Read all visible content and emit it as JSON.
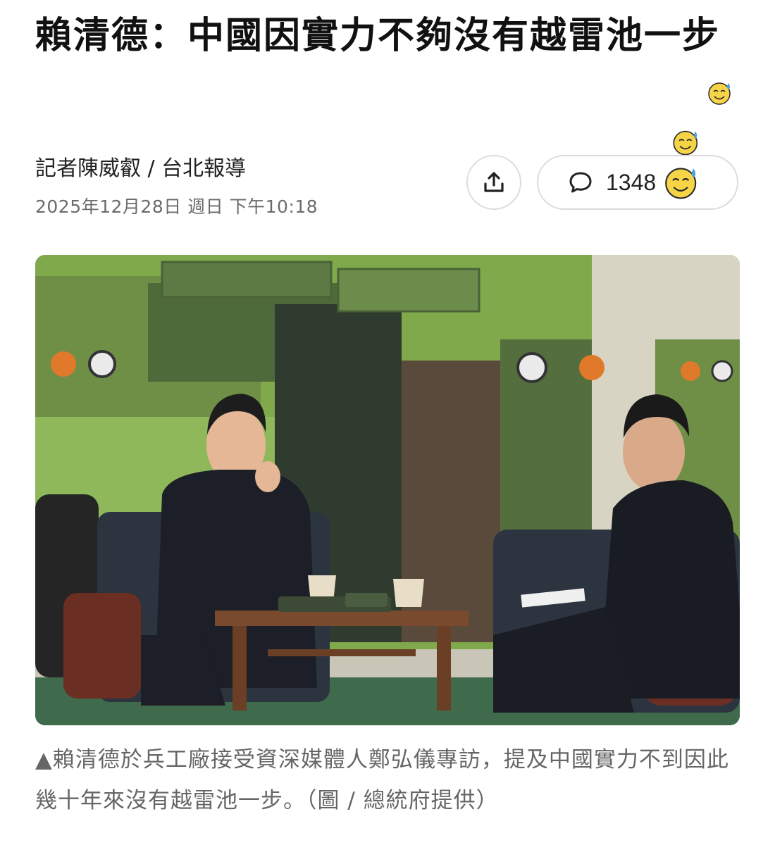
{
  "article": {
    "headline": "賴清德：中國因實力不夠沒有越雷池一步",
    "reporter": "記者陳威叡 / 台北報導",
    "timestamp": "2025年12月28日 週日 下午10:18"
  },
  "actions": {
    "share_icon": "share-icon",
    "comment_icon": "comment-bubble-icon",
    "comment_count": "1348"
  },
  "photo": {
    "caption": "▲賴清德於兵工廠接受資深媒體人鄭弘儀專訪，提及中國實力不到因此幾十年來沒有越雷池一步。（圖 / 總統府提供）"
  },
  "colors": {
    "camo_light": "#7fa94a",
    "camo_dark": "#2f3b2e",
    "camo_brown": "#5a4a3c",
    "camo_mid": "#556e3e",
    "emoji_yellow": "#f5d547",
    "sweat_blue": "#4aa3e0"
  }
}
